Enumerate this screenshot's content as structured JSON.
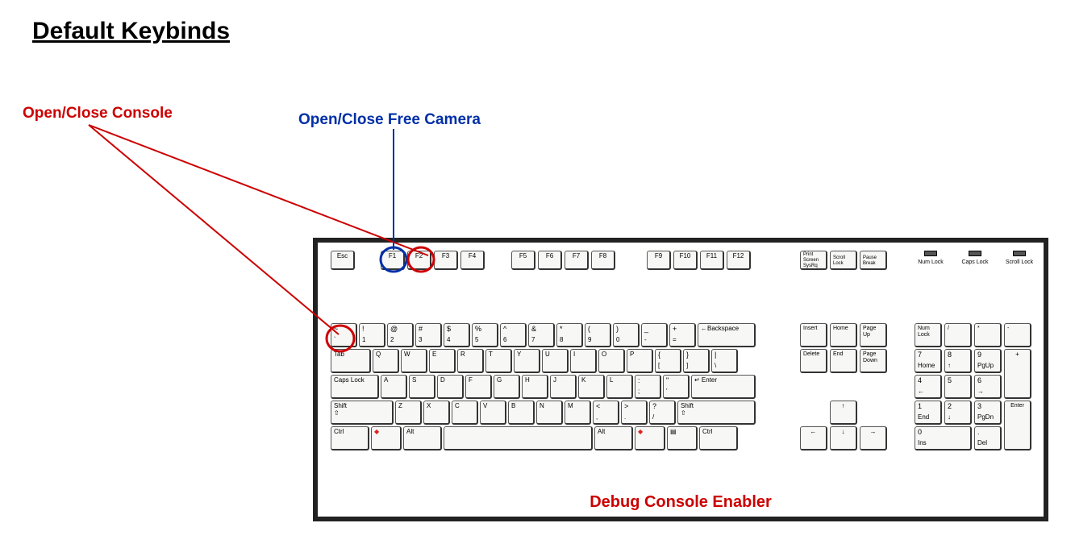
{
  "title": "Default Keybinds",
  "labels": {
    "console": "Open/Close Console",
    "camera": "Open/Close Free Camera",
    "footer": "Debug Console Enabler"
  },
  "annotations": {
    "console_target_key": "F2",
    "console_target_key2": "~",
    "camera_target_key": "F1",
    "colors": {
      "console": "#cc0000",
      "camera": "#002fa7"
    }
  },
  "indicators": [
    "Num Lock",
    "Caps Lock",
    "Scroll Lock"
  ],
  "keyboard": {
    "row_fn": [
      "Esc",
      "F1",
      "F2",
      "F3",
      "F4",
      "F5",
      "F6",
      "F7",
      "F8",
      "F9",
      "F10",
      "F11",
      "F12"
    ],
    "sys": [
      [
        "Print",
        "Screen",
        "SysRq"
      ],
      [
        "Scroll",
        "Lock"
      ],
      [
        "Pause",
        "Break"
      ]
    ],
    "row_num_upper": [
      "~",
      "!",
      "@",
      "#",
      "$",
      "%",
      "^",
      "&",
      "*",
      "(",
      ")",
      "_",
      "+"
    ],
    "row_num_lower": [
      "`",
      "1",
      "2",
      "3",
      "4",
      "5",
      "6",
      "7",
      "8",
      "9",
      "0",
      "-",
      "="
    ],
    "backspace": "←Backspace",
    "tab": "Tab",
    "row_q": [
      "Q",
      "W",
      "E",
      "R",
      "T",
      "Y",
      "U",
      "I",
      "O",
      "P"
    ],
    "brackets_upper": [
      "{",
      "}",
      "|"
    ],
    "brackets_lower": [
      "[",
      "]",
      "\\"
    ],
    "caps": "Caps Lock",
    "row_a": [
      "A",
      "S",
      "D",
      "F",
      "G",
      "H",
      "J",
      "K",
      "L"
    ],
    "semi_upper": [
      ":",
      "\""
    ],
    "semi_lower": [
      ";",
      "'"
    ],
    "enter": "↵ Enter",
    "shiftL": "Shift",
    "shiftR": "Shift",
    "row_z": [
      "Z",
      "X",
      "C",
      "V",
      "B",
      "N",
      "M"
    ],
    "punct_upper": [
      "<",
      ">",
      "?"
    ],
    "punct_lower": [
      ",",
      ".",
      "/"
    ],
    "row_bottom": [
      "Ctrl",
      "Win",
      "Alt",
      "",
      "Alt",
      "Win",
      "Menu",
      "Ctrl"
    ],
    "nav_block": [
      "Insert",
      "Home",
      "Page Up",
      "Delete",
      "End",
      "Page Down"
    ],
    "arrows": [
      "↑",
      "←",
      "↓",
      "→"
    ],
    "numpad_row1": [
      "Num Lock",
      "/",
      "*",
      "-"
    ],
    "numpad_row2": [
      [
        "7",
        "Home"
      ],
      [
        "8",
        "↑"
      ],
      [
        "9",
        "PgUp"
      ]
    ],
    "numpad_plus": "+",
    "numpad_row3": [
      [
        "4",
        "←"
      ],
      [
        "5",
        ""
      ],
      [
        "6",
        "→"
      ]
    ],
    "numpad_row4": [
      [
        "1",
        "End"
      ],
      [
        "2",
        "↓"
      ],
      [
        "3",
        "PgDn"
      ]
    ],
    "numpad_enter": "Enter",
    "numpad_row5": [
      [
        "0",
        "Ins"
      ],
      [
        ".",
        "Del"
      ]
    ]
  }
}
